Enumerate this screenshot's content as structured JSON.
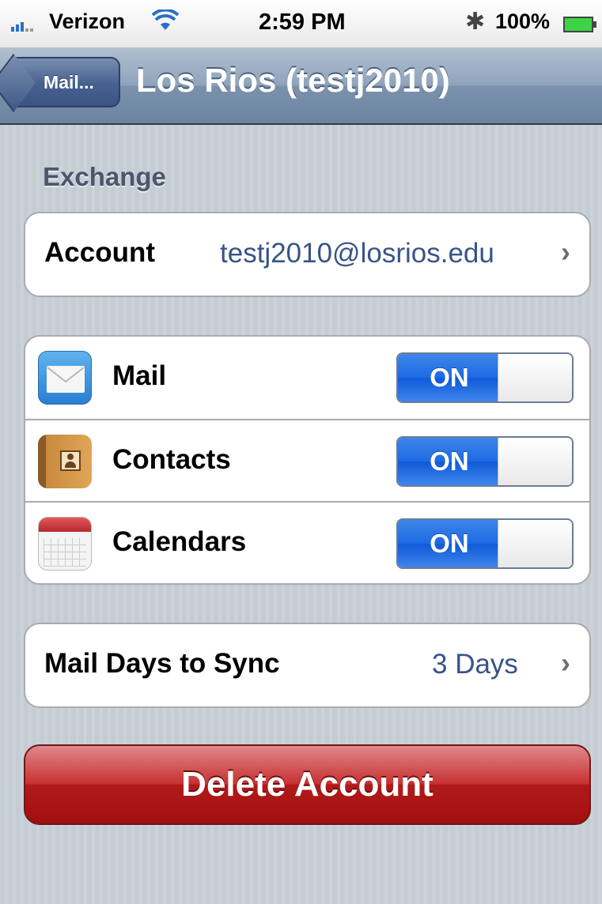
{
  "status_bar": {
    "carrier": "Verizon",
    "time": "2:59 PM",
    "battery_percent": "100%",
    "icons": [
      "signal-bars-icon",
      "wifi-icon",
      "bluetooth-icon",
      "battery-icon"
    ]
  },
  "nav": {
    "back_label": "Mail...",
    "title": "Los Rios (testj2010)"
  },
  "section_header": "Exchange",
  "account_row": {
    "label": "Account",
    "value": "testj2010@losrios.edu"
  },
  "toggles": [
    {
      "label": "Mail",
      "state": "ON",
      "icon": "mail-icon"
    },
    {
      "label": "Contacts",
      "state": "ON",
      "icon": "contacts-icon"
    },
    {
      "label": "Calendars",
      "state": "ON",
      "icon": "calendar-icon"
    }
  ],
  "sync_row": {
    "label": "Mail Days to Sync",
    "value": "3 Days"
  },
  "delete_button": "Delete Account",
  "colors": {
    "nav_bar": "#6d84a1",
    "value_text": "#385487",
    "switch_on": "#1d6ae4",
    "delete": "#b21a1a"
  }
}
